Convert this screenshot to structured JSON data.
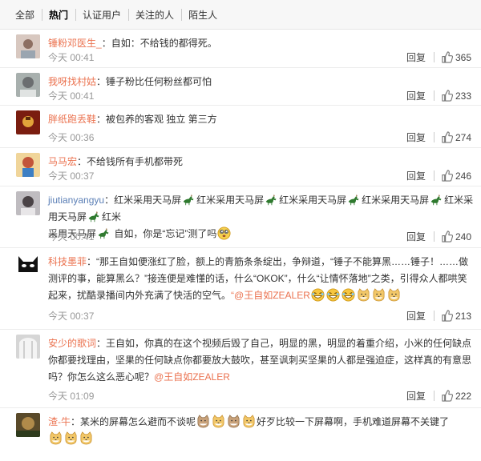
{
  "tabs": [
    "全部",
    "热门",
    "认证用户",
    "关注的人",
    "陌生人"
  ],
  "reply_label": "回复",
  "comments": [
    {
      "user": "锤粉邓医生_",
      "text": "：自如：不给钱的都得死。",
      "time": "今天 00:41",
      "likes": "365"
    },
    {
      "user": "我呀找村姑",
      "text": "：锤子粉比任何粉丝都可怕",
      "time": "今天 00:41",
      "likes": "233"
    },
    {
      "user": "胖纸跑丢鞋",
      "text": "：被包养的客观 独立 第三方",
      "time": "今天 00:36",
      "likes": "274"
    },
    {
      "user": "马马宏",
      "text": "：不给钱所有手机都带死",
      "time": "今天 00:37",
      "likes": "246"
    },
    {
      "user": "jiutianyangyu",
      "text_a": "：红米采用天马屏",
      "text_rep": "红米采用天马屏",
      "line2a": "采用天马屏",
      "line2b": " 自如，你是“忘记”测了吗",
      "time": "今天 00:41",
      "likes": "240"
    },
    {
      "user": "科技墨菲",
      "line1": "：“那王自如便涨红了脸，额上的青筋条条绽出，争辩道，“锤子不能算黑……锤子！……做",
      "line2": "测评的事，能算黑么？”接连便是难懂的话，什么“OKOK”，什么“让情怀落地”之类，引得众人都哄笑",
      "line3a": "起来，扰酷录播间内外充满了快活的空气。",
      "line3b": "“@王自如ZEALER",
      "time": "今天 00:37",
      "likes": "213"
    },
    {
      "user": "安少的歌词",
      "line1": "：王自如，你真的在这个视频后毁了自己，明显的黑，明显的着重介绍，小米的任何缺点",
      "line2": "你都要找理由，坚果的任何缺点你都要放大鼓吹，甚至讽刺买坚果的人都是强迫症，这样真的有意思",
      "line3a": "吗？你怎么这么恶心呢？",
      "line3b": "@王自如ZEALER",
      "time": "今天 01:09",
      "likes": "222"
    },
    {
      "user": "渣-牛",
      "line1a": "：某米的屏幕怎么避而不谈呢",
      "line1b": "好歹比较一下屏幕啊，手机难道屏幕不关键了"
    }
  ],
  "colors": {
    "username": "#eb7350",
    "username_alt": "#5b7fb6",
    "meta": "#999999"
  },
  "icons": {
    "like": "thumbs-up-icon",
    "horse": "horse-emoticon",
    "laugh": "laugh-emoticon",
    "doge": "doge-emoticon",
    "confused": "dizzy-emoticon"
  }
}
